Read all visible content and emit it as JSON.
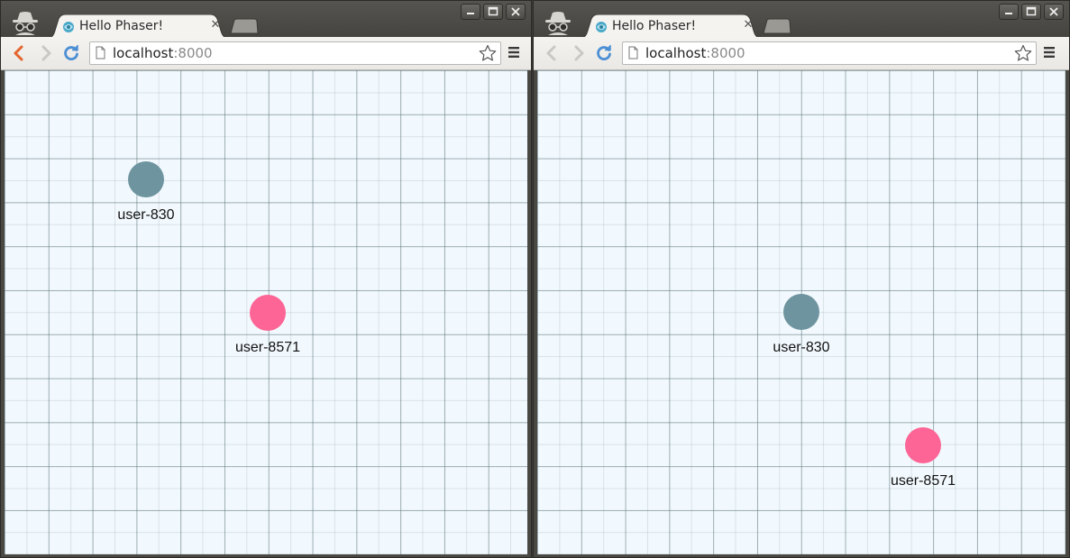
{
  "windows": [
    {
      "tab_title": "Hello Phaser!",
      "tab_close": "✕",
      "url_host": "localhost",
      "url_port": ":8000",
      "players": [
        {
          "name": "user-830",
          "color": "#6e949f"
        },
        {
          "name": "user-8571",
          "color": "#fc6595"
        }
      ]
    },
    {
      "tab_title": "Hello Phaser!",
      "tab_close": "✕",
      "url_host": "localhost",
      "url_port": ":8000",
      "players": [
        {
          "name": "user-830",
          "color": "#6e949f"
        },
        {
          "name": "user-8571",
          "color": "#fc6595"
        }
      ]
    }
  ]
}
